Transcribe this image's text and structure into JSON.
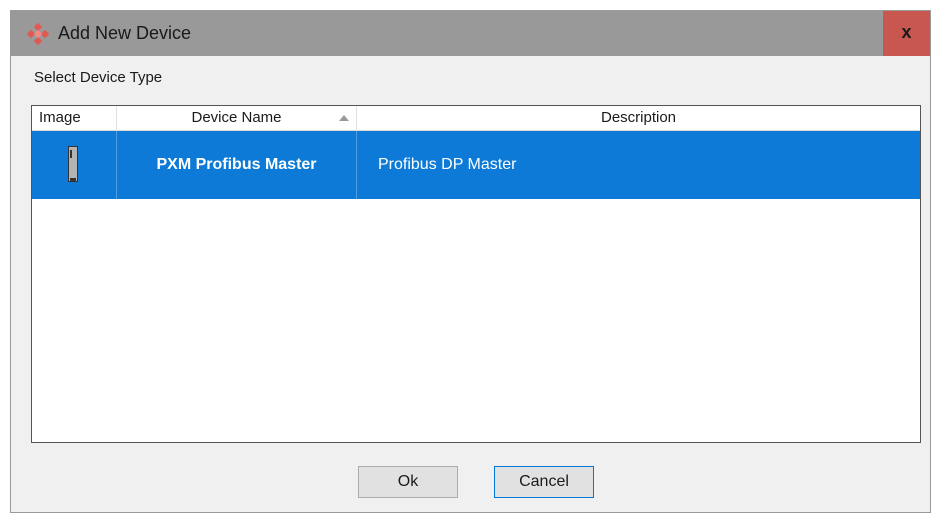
{
  "window": {
    "title": "Add New Device",
    "close_label": "x"
  },
  "section_label": "Select Device Type",
  "grid": {
    "columns": [
      "Image",
      "Device Name",
      "Description"
    ],
    "rows": [
      {
        "device_name": "PXM Profibus Master",
        "description": "Profibus DP Master",
        "selected": true
      }
    ]
  },
  "buttons": {
    "ok_label": "Ok",
    "cancel_label": "Cancel"
  },
  "colors": {
    "selection": "#0c7ad6",
    "titlebar": "#999999",
    "close": "#c8584f"
  },
  "icons": {
    "app": "diamond-logo-icon",
    "sort": "sort-ascending-icon",
    "device": "device-module-icon"
  }
}
